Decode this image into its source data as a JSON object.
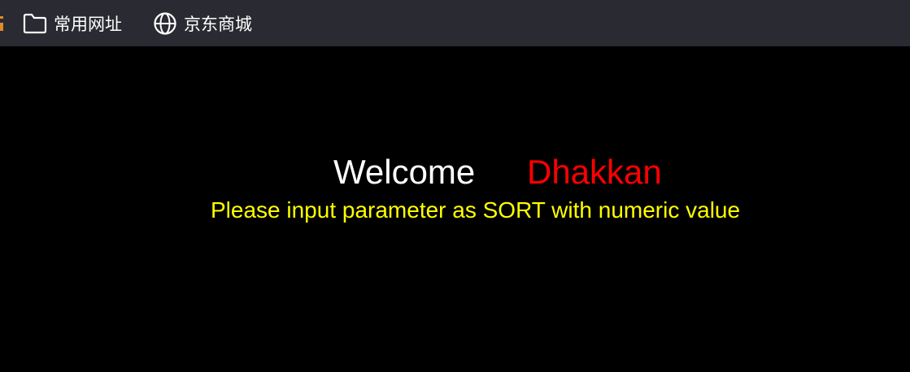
{
  "bookmarks_bar": {
    "items": [
      {
        "label": "常用网址",
        "icon": "folder-icon"
      },
      {
        "label": "京东商城",
        "icon": "globe-icon"
      }
    ]
  },
  "page": {
    "welcome": "Welcome",
    "name": "Dhakkan",
    "message": "Please input parameter as SORT with numeric value",
    "colors": {
      "welcome": "#ffffff",
      "name": "#ff0000",
      "message": "#ffff00",
      "background": "#000000"
    }
  }
}
